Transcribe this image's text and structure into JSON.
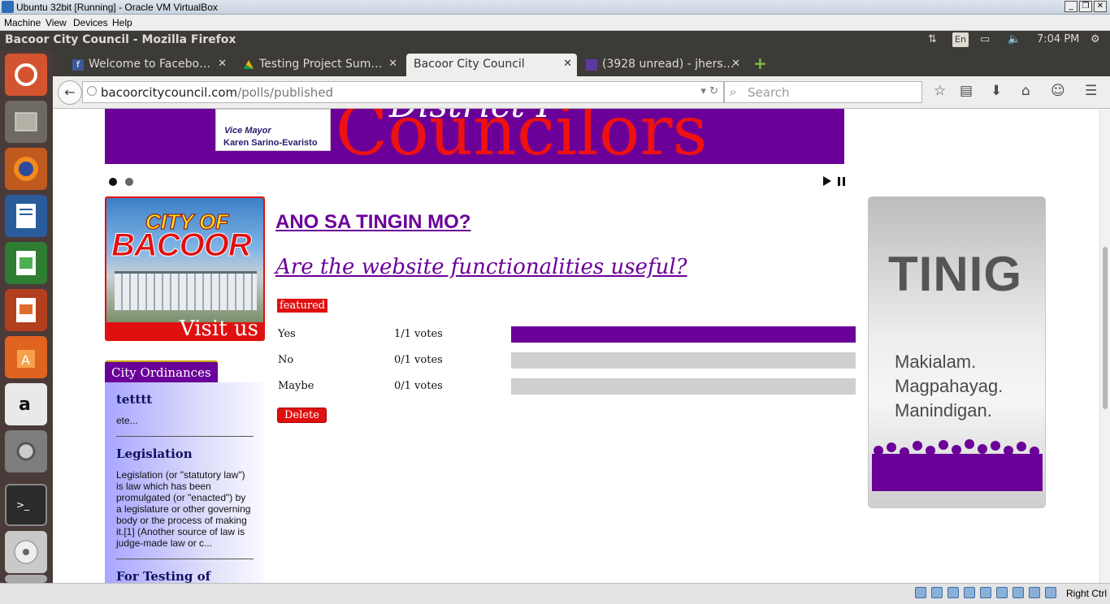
{
  "vbox": {
    "window_title": "Ubuntu 32bit [Running] - Oracle VM VirtualBox",
    "menu": [
      "Machine",
      "View",
      "Devices",
      "Help"
    ],
    "host_key": "Right Ctrl"
  },
  "panel": {
    "window_title": "Bacoor City Council - Mozilla Firefox",
    "lang": "En",
    "clock": "7:04 PM"
  },
  "launcher": {
    "items": [
      "ubuntu-dash-icon",
      "files-icon",
      "firefox-icon",
      "writer-icon",
      "calc-icon",
      "impress-icon",
      "software-center-icon",
      "amazon-icon",
      "system-settings-icon",
      "terminal-icon",
      "dvd-icon",
      "drive-icon"
    ]
  },
  "tabs": [
    {
      "label": "Welcome to Facebo…",
      "icon": "facebook-icon",
      "color": "#3b5998"
    },
    {
      "label": "Testing Project Sum…",
      "icon": "google-drive-icon",
      "color": "#f4b400"
    },
    {
      "label": "Bacoor City Council",
      "icon": "",
      "active": true
    },
    {
      "label": "(3928 unread) - jhers…",
      "icon": "mail-icon",
      "color": "#5b3a9c"
    }
  ],
  "nav": {
    "url_domain": "bacoorcitycouncil.com",
    "url_path": "/polls/published",
    "search_placeholder": "Search"
  },
  "banner": {
    "district": "District I",
    "title": "Councilors",
    "vice_mayor_label": "Vice Mayor",
    "vice_mayor_name": "Karen Sarino-Evaristo"
  },
  "ad": {
    "city_of": "CITY OF",
    "bacoor": "BACOOR",
    "visit": "Visit us"
  },
  "ordinances": {
    "tab_label": "City Ordinances",
    "items": [
      {
        "title": "tetttt",
        "text": "ete..."
      },
      {
        "title": "Legislation",
        "text": "Legislation (or \"statutory law\") is law which has been promulgated (or \"enacted\") by a legislature or other governing body or the process of making it.[1] (Another source of law is judge-made law or c..."
      },
      {
        "title": "For Testing of",
        "text": ""
      }
    ]
  },
  "poll": {
    "heading": "ANO SA TINGIN MO?",
    "question": "Are the website functionalities useful?",
    "badge": "featured",
    "options": [
      {
        "label": "Yes",
        "votes": "1/1 votes",
        "share": 1.0
      },
      {
        "label": "No",
        "votes": "0/1 votes",
        "share": 0.0
      },
      {
        "label": "Maybe",
        "votes": "0/1 votes",
        "share": 0.0
      }
    ],
    "delete_label": "Delete",
    "accent": "#6b0099",
    "danger": "#e01010"
  },
  "tinig": {
    "title": "TINIG",
    "lines": [
      "Makialam.",
      "Magpahayag.",
      "Manindigan."
    ]
  }
}
